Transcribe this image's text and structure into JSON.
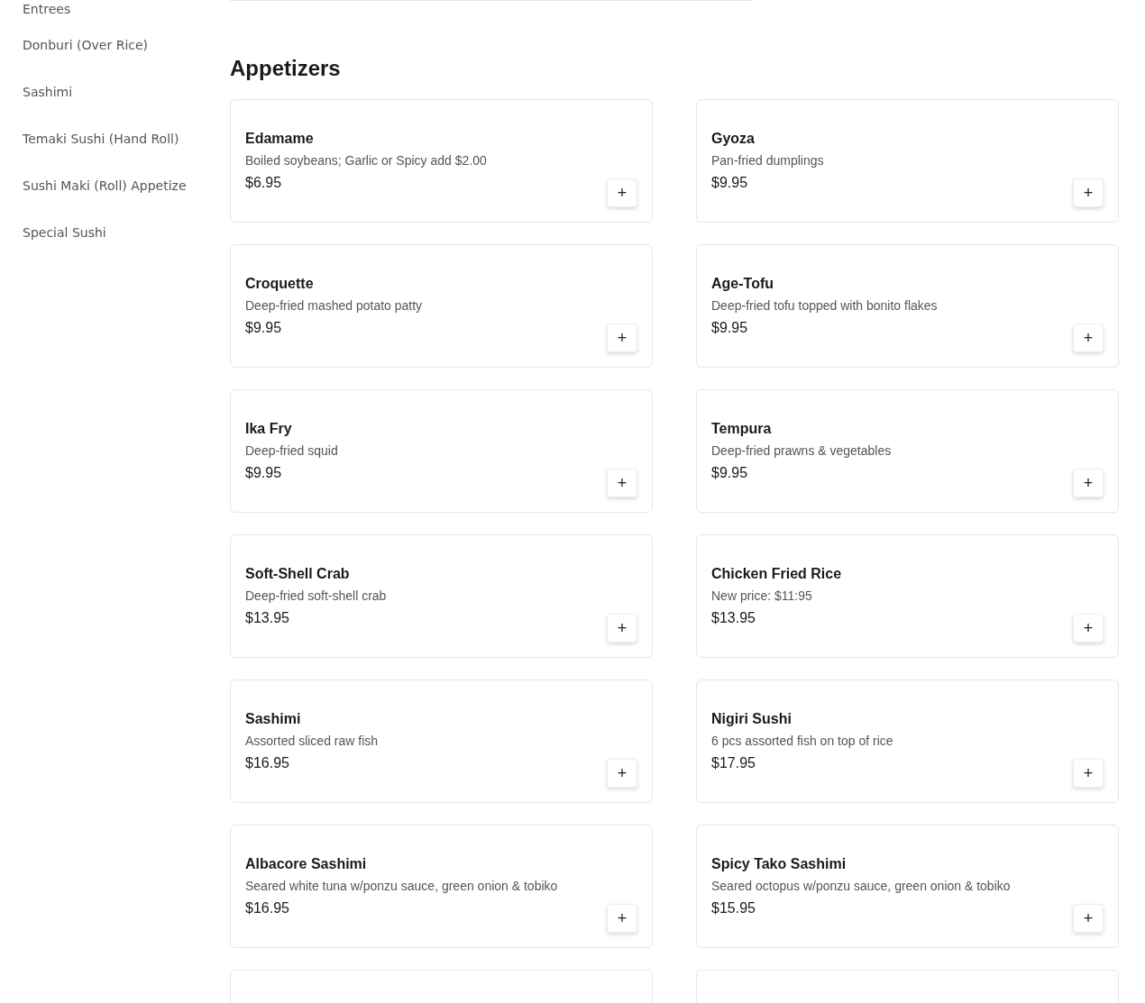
{
  "sidebar": {
    "items": [
      {
        "label": "Entrees"
      },
      {
        "label": "Donburi (Over Rice)"
      },
      {
        "label": "Sashimi"
      },
      {
        "label": "Temaki Sushi (Hand Roll)"
      },
      {
        "label": "Sushi Maki (Roll) Appetize"
      },
      {
        "label": "Special Sushi"
      }
    ]
  },
  "section": {
    "title": "Appetizers",
    "items": [
      {
        "name": "Edamame",
        "description": "Boiled soybeans; Garlic or Spicy add $2.00",
        "price": "$6.95",
        "button": "+"
      },
      {
        "name": "Gyoza",
        "description": "Pan-fried dumplings",
        "price": "$9.95",
        "button": "+"
      },
      {
        "name": "Croquette",
        "description": "Deep-fried mashed potato patty",
        "price": "$9.95",
        "button": "+"
      },
      {
        "name": "Age-Tofu",
        "description": "Deep-fried tofu topped with bonito flakes",
        "price": "$9.95",
        "button": "+"
      },
      {
        "name": "Ika Fry",
        "description": "Deep-fried squid",
        "price": "$9.95",
        "button": "+"
      },
      {
        "name": "Tempura",
        "description": "Deep-fried prawns & vegetables",
        "price": "$9.95",
        "button": "+"
      },
      {
        "name": "Soft-Shell Crab",
        "description": "Deep-fried soft-shell crab",
        "price": "$13.95",
        "button": "+"
      },
      {
        "name": "Chicken Fried Rice",
        "description": "New price: $11:95",
        "price": "$13.95",
        "button": "+"
      },
      {
        "name": "Sashimi",
        "description": "Assorted sliced raw fish",
        "price": "$16.95",
        "button": "+"
      },
      {
        "name": "Nigiri Sushi",
        "description": "6 pcs assorted fish on top of rice",
        "price": "$17.95",
        "button": "+"
      },
      {
        "name": "Albacore Sashimi",
        "description": "Seared white tuna w/ponzu sauce, green onion & tobiko",
        "price": "$16.95",
        "button": "+"
      },
      {
        "name": "Spicy Tako Sashimi",
        "description": "Seared octopus w/ponzu sauce, green onion & tobiko",
        "price": "$15.95",
        "button": "+"
      }
    ]
  }
}
